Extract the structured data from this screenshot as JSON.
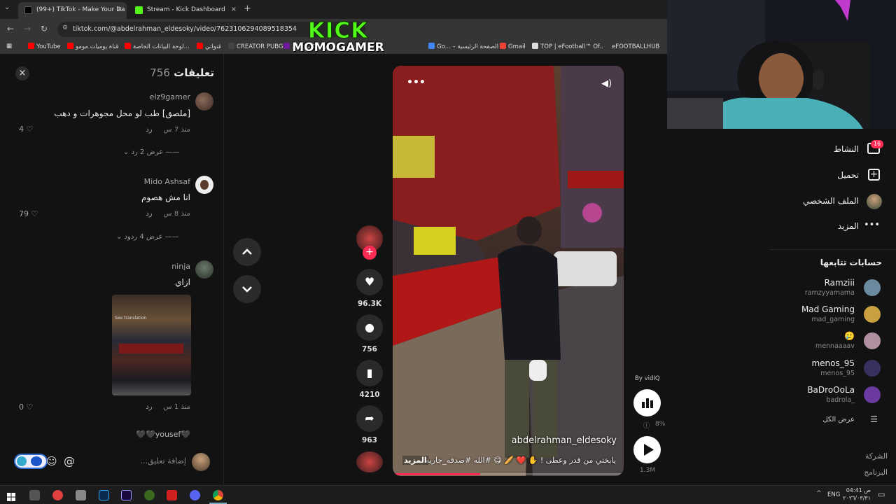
{
  "browser": {
    "tabs": [
      {
        "label": "(99+) TikTok - Make Your Da",
        "active": true
      },
      {
        "label": "Stream - Kick Dashboard",
        "active": false
      }
    ],
    "url": "tiktok.com/@abdelrahman_eldesoky/video/7623106294089518354",
    "bookmarks": [
      "YouTube",
      "قناة يوميات مومو",
      "لوحة البيانات الخاصة...",
      "قنواتي",
      "CREATOR PUBG",
      "كيف تكتب علي",
      "Go... – الصفحة الرئيسية",
      "Gmail",
      "TOP | eFootball™ Of...",
      "eFOOTBALLHUB"
    ]
  },
  "overlay": {
    "kick": "KICK",
    "channel": "MOMOGAMER"
  },
  "comments": {
    "title": "تعليقات",
    "count": "756",
    "items": [
      {
        "user": "elz9gamer",
        "text": "[ملصق] طب لو محل مجوهرات و دهب",
        "time": "منذ 7 س",
        "reply": "رد",
        "likes": "4",
        "view_replies": "عرض 2 رد"
      },
      {
        "user": "Mido Ashsaf",
        "text": "انا مش هصوم",
        "time": "منذ 8 س",
        "reply": "رد",
        "likes": "79",
        "view_replies": "عرض 4 ردود"
      },
      {
        "user": "ninja",
        "text": "ازاي",
        "time": "منذ 1 س",
        "reply": "رد",
        "likes": "0",
        "image_caption": "See translation"
      },
      {
        "user": "",
        "text": "🖤yousef🖤🖤",
        "time": "",
        "reply": "",
        "likes": ""
      }
    ],
    "input_placeholder": "إضافة تعليق..."
  },
  "video": {
    "author": "abdelrahman_eldesoky",
    "caption": "يابختي من قدر وعطى ! ✋ ❤️ 🥖 😋 #الله #صدقه_جارية",
    "more": "المزيد",
    "likes": "96.3K",
    "comments": "756",
    "saves": "4210",
    "shares": "963",
    "vidiq_label": "By vidIQ",
    "vidiq_percent": "8%",
    "views": "1.3M",
    "progress_fraction": 0.38
  },
  "sidebar": {
    "activity": "النشاط",
    "activity_badge": "16",
    "upload": "تحميل",
    "profile": "الملف الشخصي",
    "more": "المزيد",
    "following_title": "حسابات تتابعها",
    "following": [
      {
        "name": "Ramziii",
        "user": "ramzyyamama"
      },
      {
        "name": "Mad Gaming",
        "user": "mad_gaming"
      },
      {
        "name": "🥲",
        "user": "mennaaaav"
      },
      {
        "name": "menos_95",
        "user": "menos_95"
      },
      {
        "name": "BaDroOoLa",
        "user": "badrola_"
      }
    ],
    "see_all": "عرض الكل",
    "footer1": "الشركة",
    "footer2": "البرنامج"
  },
  "taskbar": {
    "lang": "ENG",
    "time": "04:41 ص",
    "date": "٢٠٢٦/٠٣/٣١"
  },
  "colors": {
    "accent": "#fe2c55",
    "kick": "#53fc18"
  }
}
